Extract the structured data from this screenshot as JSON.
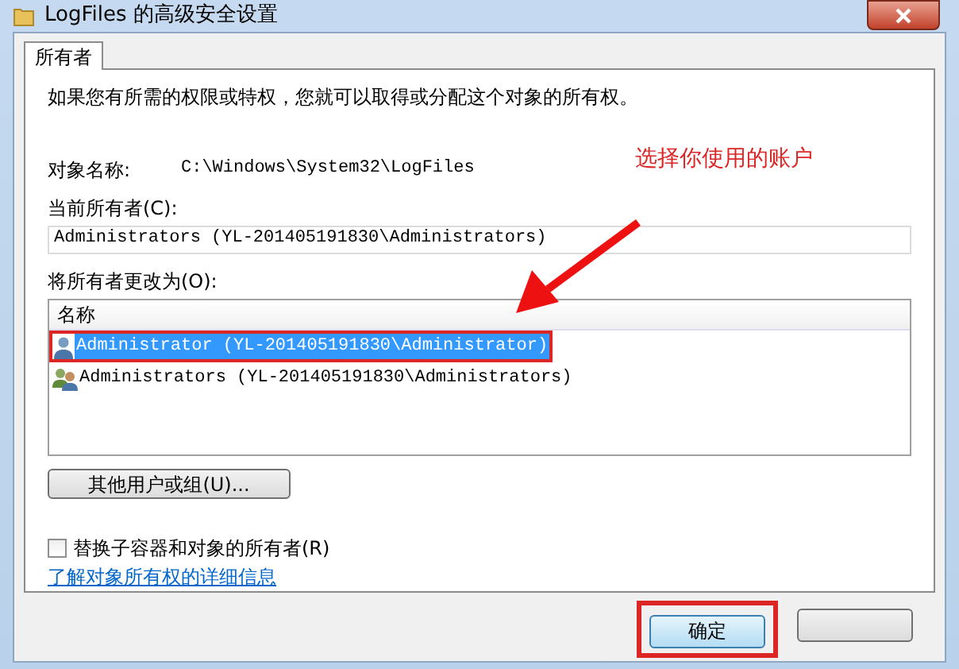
{
  "window": {
    "title": "LogFiles 的高级安全设置"
  },
  "tabs": [
    {
      "label": "所有者",
      "selected": true
    }
  ],
  "intro": "如果您有所需的权限或特权，您就可以取得或分配这个对象的所有权。",
  "object_name": {
    "label": "对象名称:",
    "value": "C:\\Windows\\System32\\LogFiles"
  },
  "current_owner": {
    "label": "当前所有者(C):",
    "value": "Administrators (YL-201405191830\\Administrators)"
  },
  "change_owner": {
    "label": "将所有者更改为(O):",
    "column": "名称",
    "rows": [
      {
        "kind": "user",
        "name": "Administrator (YL-201405191830\\Administrator)",
        "selected": true,
        "highlighted": true
      },
      {
        "kind": "group",
        "name": "Administrators (YL-201405191830\\Administrators)",
        "selected": false,
        "highlighted": false
      }
    ]
  },
  "other_button": "其他用户或组(U)...",
  "replace_checkbox": {
    "label": "替换子容器和对象的所有者(R)",
    "checked": false
  },
  "link": "了解对象所有权的详细信息",
  "buttons": [
    {
      "kind": "ok",
      "label": "确定",
      "highlighted": true
    },
    {
      "kind": "cancel",
      "highlighted": false
    }
  ],
  "annotation": {
    "text": "选择你使用的账户",
    "color": "#dc2626"
  }
}
